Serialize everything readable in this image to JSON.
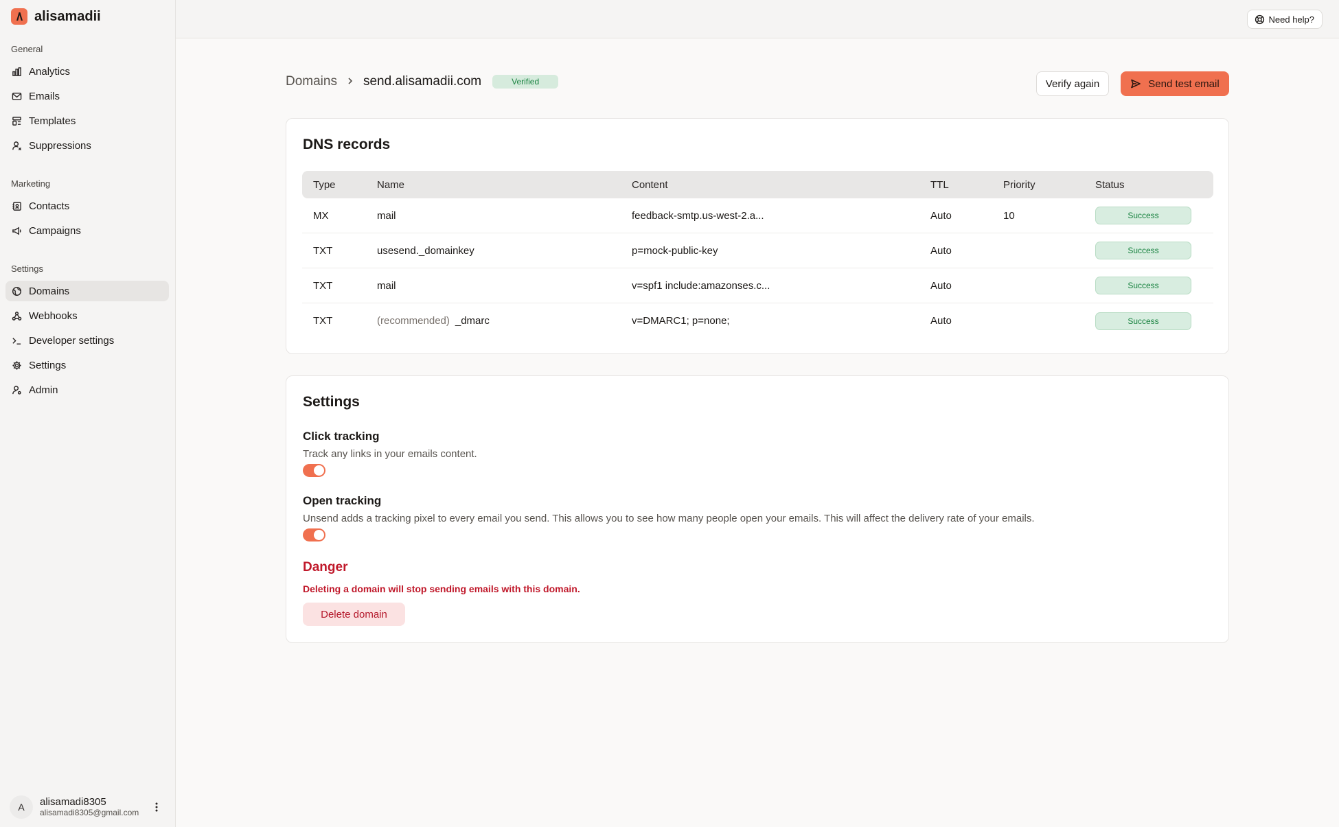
{
  "sidebar": {
    "brand_name": "alisamadii",
    "groups": {
      "general": "General",
      "marketing": "Marketing",
      "settings": "Settings"
    },
    "items": {
      "analytics": "Analytics",
      "emails": "Emails",
      "templates": "Templates",
      "suppressions": "Suppressions",
      "contacts": "Contacts",
      "campaigns": "Campaigns",
      "domains": "Domains",
      "webhooks": "Webhooks",
      "developer": "Developer settings",
      "settings": "Settings",
      "admin": "Admin"
    },
    "active_item": "Domains",
    "user": {
      "initial": "A",
      "name": "alisamadi8305",
      "email": "alisamadi8305@gmail.com"
    }
  },
  "topbar": {
    "help_label": "Need help?"
  },
  "header": {
    "breadcrumb_root": "Domains",
    "breadcrumb_current": "send.alisamadii.com",
    "badge": "Verified",
    "verify_label": "Verify again",
    "send_label": "Send test email"
  },
  "dns": {
    "title": "DNS records",
    "columns": {
      "type": "Type",
      "name": "Name",
      "content": "Content",
      "ttl": "TTL",
      "priority": "Priority",
      "status": "Status"
    },
    "rows": [
      {
        "type": "MX",
        "prefix": "",
        "name": "mail",
        "content": "feedback-smtp.us-west-2.a...",
        "ttl": "Auto",
        "priority": "10",
        "status": "Success"
      },
      {
        "type": "TXT",
        "prefix": "",
        "name": "usesend._domainkey",
        "content": "p=mock-public-key",
        "ttl": "Auto",
        "priority": "",
        "status": "Success"
      },
      {
        "type": "TXT",
        "prefix": "",
        "name": "mail",
        "content": "v=spf1 include:amazonses.c...",
        "ttl": "Auto",
        "priority": "",
        "status": "Success"
      },
      {
        "type": "TXT",
        "prefix": "(recommended)",
        "name": "_dmarc",
        "content": "v=DMARC1; p=none;",
        "ttl": "Auto",
        "priority": "",
        "status": "Success"
      }
    ]
  },
  "settings": {
    "title": "Settings",
    "click_tracking": {
      "label": "Click tracking",
      "description": "Track any links in your emails content.",
      "enabled": true
    },
    "open_tracking": {
      "label": "Open tracking",
      "description": "Unsend adds a tracking pixel to every email you send. This allows you to see how many people open your emails. This will affect the delivery rate of your emails.",
      "enabled": true
    },
    "danger": {
      "title": "Danger",
      "description": "Deleting a domain will stop sending emails with this domain.",
      "button": "Delete domain"
    }
  },
  "colors": {
    "accent": "#f0704f",
    "success_bg": "#d8ede0",
    "success_text": "#15803d",
    "danger": "#c0182a"
  }
}
